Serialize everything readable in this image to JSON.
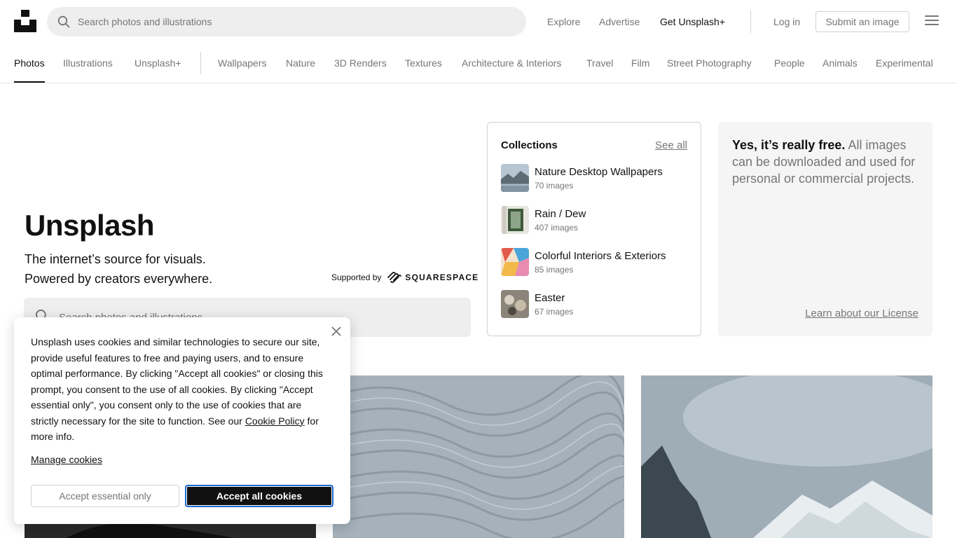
{
  "header": {
    "search_placeholder": "Search photos and illustrations",
    "nav": {
      "explore": "Explore",
      "advertise": "Advertise",
      "get_plus": "Get Unsplash+",
      "login": "Log in",
      "submit": "Submit an image"
    }
  },
  "tabs": [
    {
      "label": "Photos",
      "active": true
    },
    {
      "label": "Illustrations"
    },
    {
      "label": "Unsplash+"
    },
    {
      "label": "Wallpapers"
    },
    {
      "label": "Nature"
    },
    {
      "label": "3D Renders"
    },
    {
      "label": "Textures"
    },
    {
      "label": "Architecture & Interiors"
    },
    {
      "label": "Travel"
    },
    {
      "label": "Film"
    },
    {
      "label": "Street Photography"
    },
    {
      "label": "People"
    },
    {
      "label": "Animals"
    },
    {
      "label": "Experimental"
    }
  ],
  "hero": {
    "title": "Unsplash",
    "subtitle_line1": "The internet’s source for visuals.",
    "subtitle_line2": "Powered by creators everywhere.",
    "supported_by": "Supported by",
    "sponsor": "SQUARESPACE",
    "search_placeholder": "Search photos and illustrations"
  },
  "collections": {
    "title": "Collections",
    "see_all": "See all",
    "items": [
      {
        "name": "Nature Desktop Wallpapers",
        "count": "70 images"
      },
      {
        "name": "Rain / Dew",
        "count": "407 images"
      },
      {
        "name": "Colorful Interiors & Exteriors",
        "count": "85 images"
      },
      {
        "name": "Easter",
        "count": "67 images"
      }
    ]
  },
  "free_card": {
    "bold": "Yes, it’s really free.",
    "rest": " All images can be downloaded and used for personal or commercial projects.",
    "license_link": "Learn about our License"
  },
  "cookie": {
    "msg_part1": "Unsplash uses cookies and similar technologies to secure our site, provide useful features to free and paying users, and to ensure optimal performance. By clicking \"Accept all cookies\" or closing this prompt, you consent to the use of all cookies. By clicking \"Accept essential only\", you consent only to the use of cookies that are strictly necessary for the site to function. See our ",
    "policy_link": "Cookie Policy",
    "msg_part2": " for more info.",
    "manage": "Manage cookies",
    "accept_essential": "Accept essential only",
    "accept_all": "Accept all cookies"
  },
  "colors": {
    "primary_text": "#111111",
    "secondary_text": "#767676",
    "focus_ring": "#1b6dd1"
  }
}
